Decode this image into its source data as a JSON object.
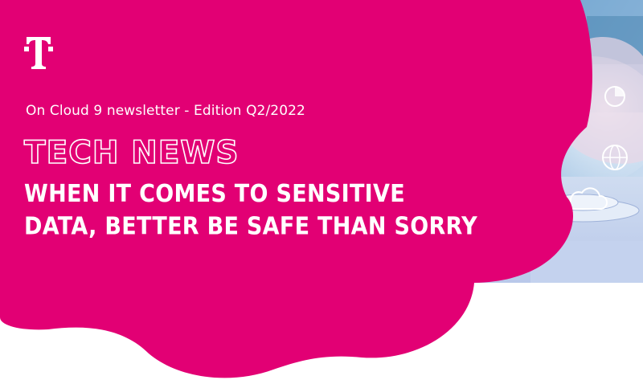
{
  "brand": {
    "logo_icon": "telekom-t-logo-icon",
    "accent_color": "#e20074"
  },
  "newsletter": {
    "edition_line": "On Cloud 9 newsletter - Edition Q2/2022",
    "section_title": "TECH NEWS",
    "headline_lines": [
      "WHEN IT COMES TO SENSITIVE",
      "DATA, BETTER BE SAFE THAN SORRY"
    ]
  },
  "hero": {
    "icons": [
      "pie-chart-icon",
      "globe-icon",
      "cloud-icon"
    ]
  }
}
